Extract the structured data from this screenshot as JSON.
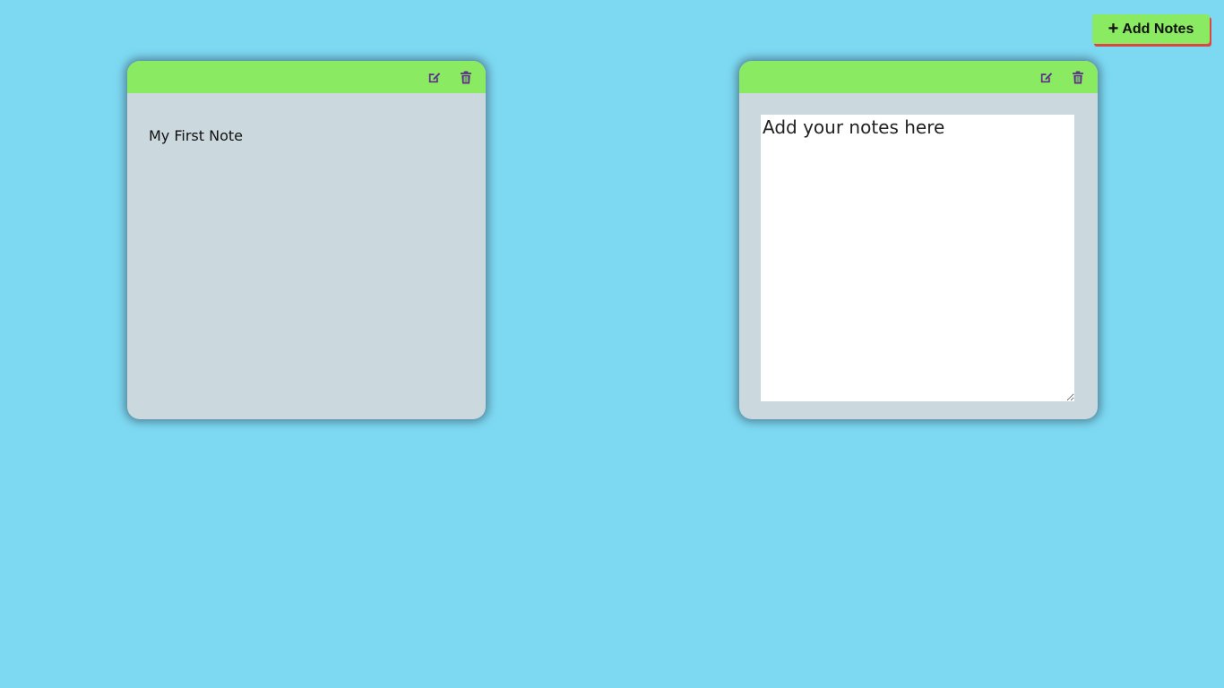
{
  "toolbar": {
    "add_button_icon": "+",
    "add_button_label": "Add Notes",
    "add_button_color": "#8aea61",
    "add_button_shadow": "#d94848"
  },
  "notes": [
    {
      "header_color": "#8aea61",
      "edit_icon": "edit-icon",
      "delete_icon": "trash-icon",
      "text": "My First Note"
    },
    {
      "header_color": "#8aea61",
      "edit_icon": "edit-icon",
      "delete_icon": "trash-icon",
      "placeholder": "Add your notes here",
      "value": ""
    }
  ],
  "colors": {
    "background": "#7dd9f2",
    "note_body": "#cbd9df",
    "icon": "#5b2d8c"
  }
}
